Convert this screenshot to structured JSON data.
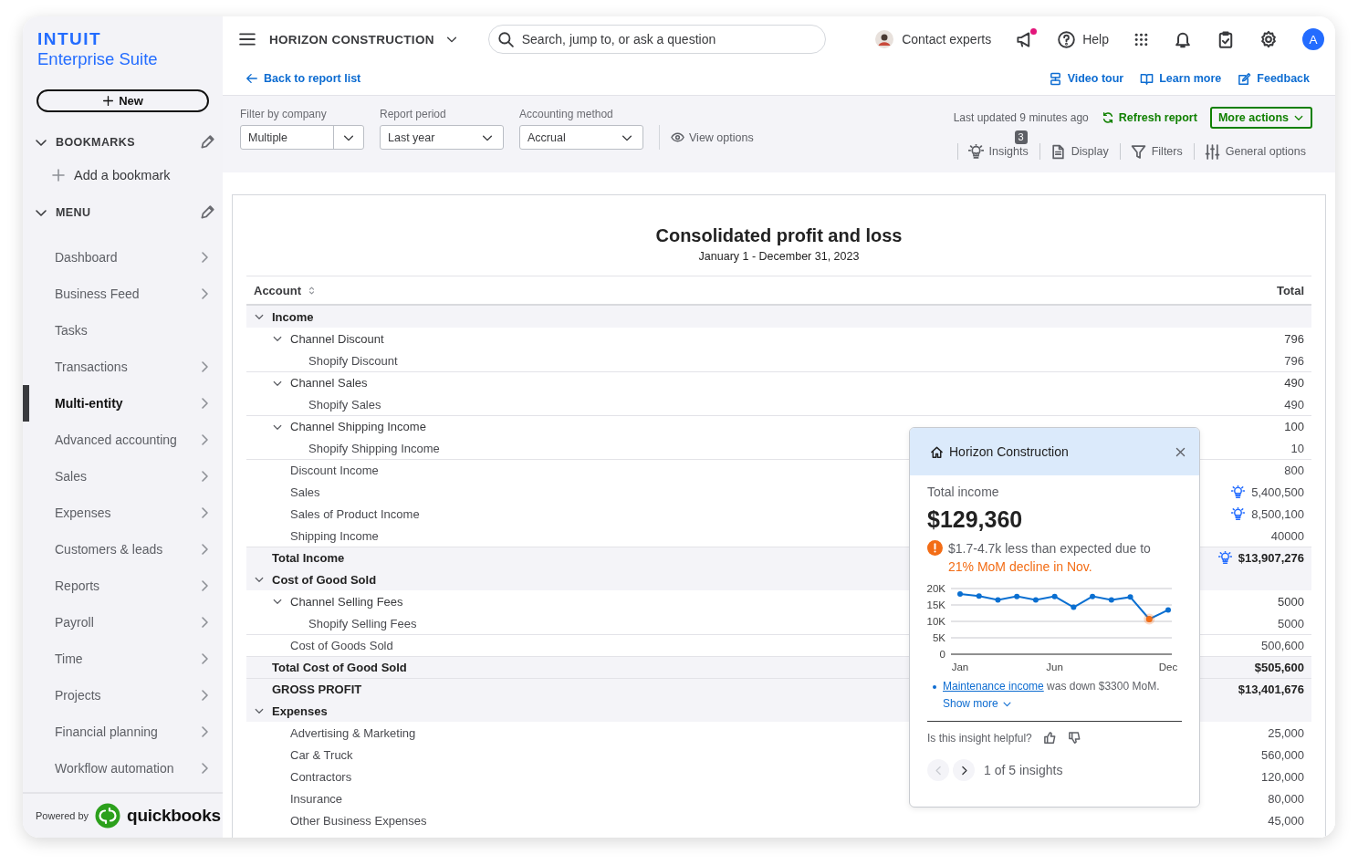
{
  "brand": {
    "logo": "INTUIT",
    "product": "Enterprise Suite"
  },
  "new_button": {
    "label": "New"
  },
  "bookmarks": {
    "title": "BOOKMARKS",
    "expanded": true,
    "add_label": "Add a bookmark"
  },
  "menu": {
    "title": "MENU",
    "expanded": true,
    "items": [
      {
        "label": "Dashboard",
        "has_submenu": true,
        "selected": false
      },
      {
        "label": "Business Feed",
        "has_submenu": true,
        "selected": false
      },
      {
        "label": "Tasks",
        "has_submenu": false,
        "selected": false
      },
      {
        "label": "Transactions",
        "has_submenu": true,
        "selected": false
      },
      {
        "label": "Multi-entity",
        "has_submenu": true,
        "selected": true
      },
      {
        "label": "Advanced accounting",
        "has_submenu": true,
        "selected": false
      },
      {
        "label": "Sales",
        "has_submenu": true,
        "selected": false
      },
      {
        "label": "Expenses",
        "has_submenu": true,
        "selected": false
      },
      {
        "label": "Customers & leads",
        "has_submenu": true,
        "selected": false
      },
      {
        "label": "Reports",
        "has_submenu": true,
        "selected": false
      },
      {
        "label": "Payroll",
        "has_submenu": true,
        "selected": false
      },
      {
        "label": "Time",
        "has_submenu": true,
        "selected": false
      },
      {
        "label": "Projects",
        "has_submenu": true,
        "selected": false
      },
      {
        "label": "Financial planning",
        "has_submenu": true,
        "selected": false
      },
      {
        "label": "Workflow automation",
        "has_submenu": true,
        "selected": false
      }
    ]
  },
  "footer": {
    "powered_by": "Powered by",
    "wordmark": "quickbooks"
  },
  "topbar": {
    "company": "HORIZON CONSTRUCTION",
    "search": {
      "placeholder": "Search, jump to, or ask a question"
    },
    "contact": "Contact experts",
    "announcement_dot": true,
    "help": "Help",
    "avatar": "A"
  },
  "links": {
    "back": "Back to report list",
    "right": [
      {
        "kind": "video",
        "label": "Video tour"
      },
      {
        "kind": "book",
        "label": "Learn more"
      },
      {
        "kind": "feedback",
        "label": "Feedback"
      }
    ]
  },
  "filters": [
    {
      "label": "Filter by company",
      "value": "Multiple",
      "kind": "split"
    },
    {
      "label": "Report period",
      "value": "Last year",
      "kind": "plain"
    },
    {
      "label": "Accounting method",
      "value": "Accrual",
      "kind": "plain"
    }
  ],
  "view_options": "View options",
  "last_updated": "Last updated 9 minutes ago",
  "refresh": "Refresh report",
  "more_actions": "More actions",
  "tools": [
    {
      "kind": "insights",
      "label": "Insights",
      "badge": "3"
    },
    {
      "kind": "display",
      "label": "Display"
    },
    {
      "kind": "filters",
      "label": "Filters"
    },
    {
      "kind": "general",
      "label": "General options"
    }
  ],
  "report": {
    "title": "Consolidated profit and loss",
    "subtitle": "January 1 - December 31, 2023",
    "columns": [
      "Account",
      "Total"
    ],
    "rows": [
      {
        "kind": "section",
        "account": "Income",
        "expanded": true,
        "children": [
          {
            "kind": "group",
            "account": "Channel Discount",
            "total": "796",
            "expanded": true,
            "children": [
              {
                "kind": "line",
                "account": "Shopify Discount",
                "total": "796"
              }
            ]
          },
          {
            "kind": "group",
            "account": "Channel Sales",
            "total": "490",
            "expanded": true,
            "children": [
              {
                "kind": "line",
                "account": "Shopify Sales",
                "total": "490"
              }
            ]
          },
          {
            "kind": "group",
            "account": "Channel Shipping Income",
            "total": "100",
            "expanded": true,
            "children": [
              {
                "kind": "line",
                "account": "Shopify Shipping Income",
                "total": "10"
              }
            ]
          },
          {
            "kind": "line",
            "account": "Discount Income",
            "total": "800"
          },
          {
            "kind": "line",
            "account": "Sales",
            "total": "5,400,500",
            "insight": true
          },
          {
            "kind": "line",
            "account": "Sales of Product Income",
            "total": "8,500,100",
            "insight": true
          },
          {
            "kind": "line",
            "account": "Shipping Income",
            "total": "40000"
          }
        ]
      },
      {
        "kind": "total",
        "account": "Total Income",
        "total": "$13,907,276",
        "insight": true
      },
      {
        "kind": "section",
        "account": "Cost of Good Sold",
        "expanded": true,
        "children": [
          {
            "kind": "group",
            "account": "Channel Selling Fees",
            "total": "5000",
            "expanded": true,
            "children": [
              {
                "kind": "line",
                "account": "Shopify Selling Fees",
                "total": "5000"
              }
            ]
          },
          {
            "kind": "line",
            "account": "Cost of Goods Sold",
            "total": "500,600"
          }
        ]
      },
      {
        "kind": "total",
        "account": "Total Cost of Good Sold",
        "total": "$505,600"
      },
      {
        "kind": "total",
        "account": "GROSS PROFIT",
        "total": "$13,401,676"
      },
      {
        "kind": "section",
        "account": "Expenses",
        "expanded": true,
        "children": [
          {
            "kind": "line",
            "account": "Advertising & Marketing",
            "total": "25,000"
          },
          {
            "kind": "line",
            "account": "Car & Truck",
            "total": "560,000"
          },
          {
            "kind": "line",
            "account": "Contractors",
            "total": "120,000"
          },
          {
            "kind": "line",
            "account": "Insurance",
            "total": "80,000"
          },
          {
            "kind": "line",
            "account": "Other Business Expenses",
            "total": "45,000"
          }
        ]
      }
    ]
  },
  "insight_card": {
    "title": "Horizon Construction",
    "metric_label": "Total income",
    "metric_value": "$129,360",
    "warning": "$1.7-4.7k less than expected due to",
    "warning_emphasis": "21% MoM decline in Nov.",
    "chart_data": {
      "type": "line",
      "categories": [
        "Jan",
        null,
        null,
        null,
        null,
        "Jun",
        null,
        null,
        null,
        null,
        null,
        "Dec"
      ],
      "series": [
        {
          "color": "#0a6fd1",
          "marker": true,
          "values": [
            18300,
            17700,
            16500,
            17600,
            16500,
            17600,
            14300,
            17600,
            16500,
            17400,
            10700,
            13500
          ]
        },
        {
          "color": "#f36d16",
          "marker": true,
          "values": [
            null,
            null,
            null,
            null,
            null,
            null,
            null,
            null,
            null,
            null,
            10700,
            null
          ]
        }
      ],
      "grid": true,
      "ylim": [
        0,
        20000
      ],
      "yticks": [
        {
          "value": 0,
          "label": "0"
        },
        {
          "value": 5000,
          "label": "5K"
        },
        {
          "value": 10000,
          "label": "10K"
        },
        {
          "value": 15000,
          "label": "15K"
        },
        {
          "value": 20000,
          "label": "20K"
        }
      ]
    },
    "detail_link": "Maintenance income",
    "detail_text": "was down $3300 MoM.",
    "show_more": "Show more",
    "feedback_question": "Is this insight helpful?",
    "pager": "1 of 5 insights",
    "prev_disabled": true
  }
}
